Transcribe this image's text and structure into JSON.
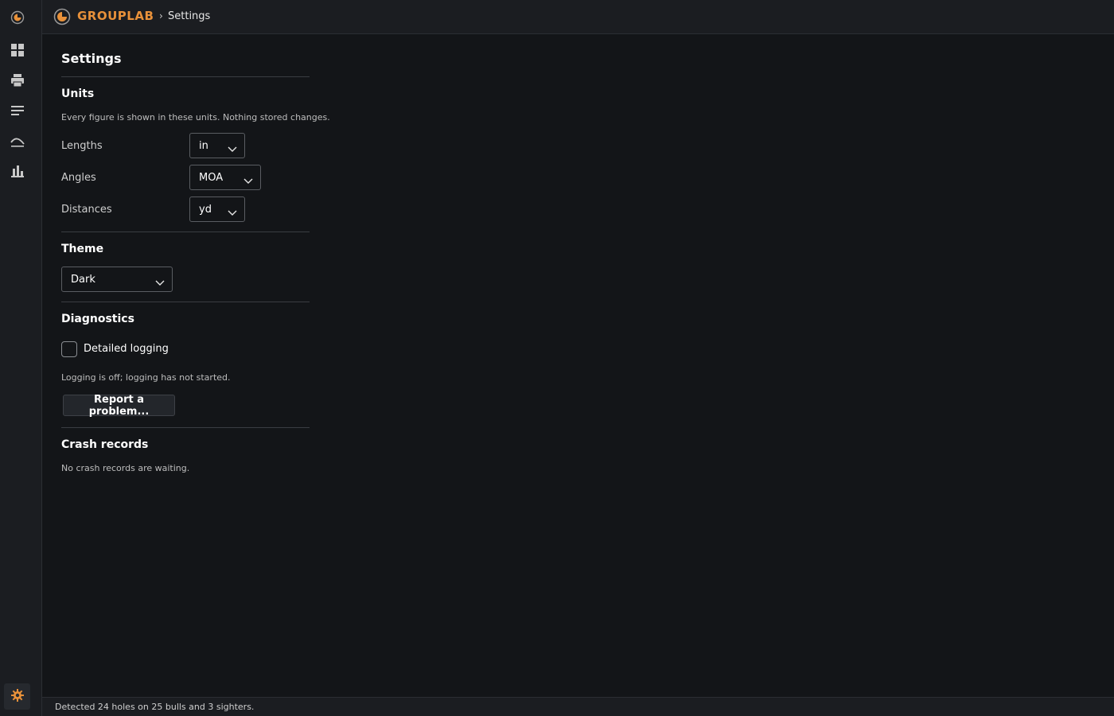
{
  "app": {
    "brand": "GROUPLAB",
    "breadcrumb_sep": "›",
    "breadcrumb": "Settings",
    "accent": "#e8913a"
  },
  "rail": {
    "items": [
      {
        "name": "app-logo-icon"
      },
      {
        "name": "dashboard-icon"
      },
      {
        "name": "printer-icon"
      },
      {
        "name": "list-icon"
      },
      {
        "name": "trajectory-icon"
      },
      {
        "name": "bar-chart-icon"
      }
    ],
    "settings": {
      "name": "gear-icon"
    }
  },
  "settings": {
    "title": "Settings",
    "units": {
      "title": "Units",
      "hint": "Every figure is shown in these units. Nothing stored changes.",
      "lengths_label": "Lengths",
      "lengths_value": "in",
      "angles_label": "Angles",
      "angles_value": "MOA",
      "distances_label": "Distances",
      "distances_value": "yd"
    },
    "theme": {
      "title": "Theme",
      "value": "Dark"
    },
    "diagnostics": {
      "title": "Diagnostics",
      "checkbox_label": "Detailed logging",
      "checked": false,
      "hint": "Logging is off; logging has not started.",
      "report_button": "Report a problem..."
    },
    "crash": {
      "title": "Crash records",
      "hint": "No crash records are waiting."
    }
  },
  "status": {
    "text": "Detected 24 holes on 25 bulls and 3 sighters."
  }
}
